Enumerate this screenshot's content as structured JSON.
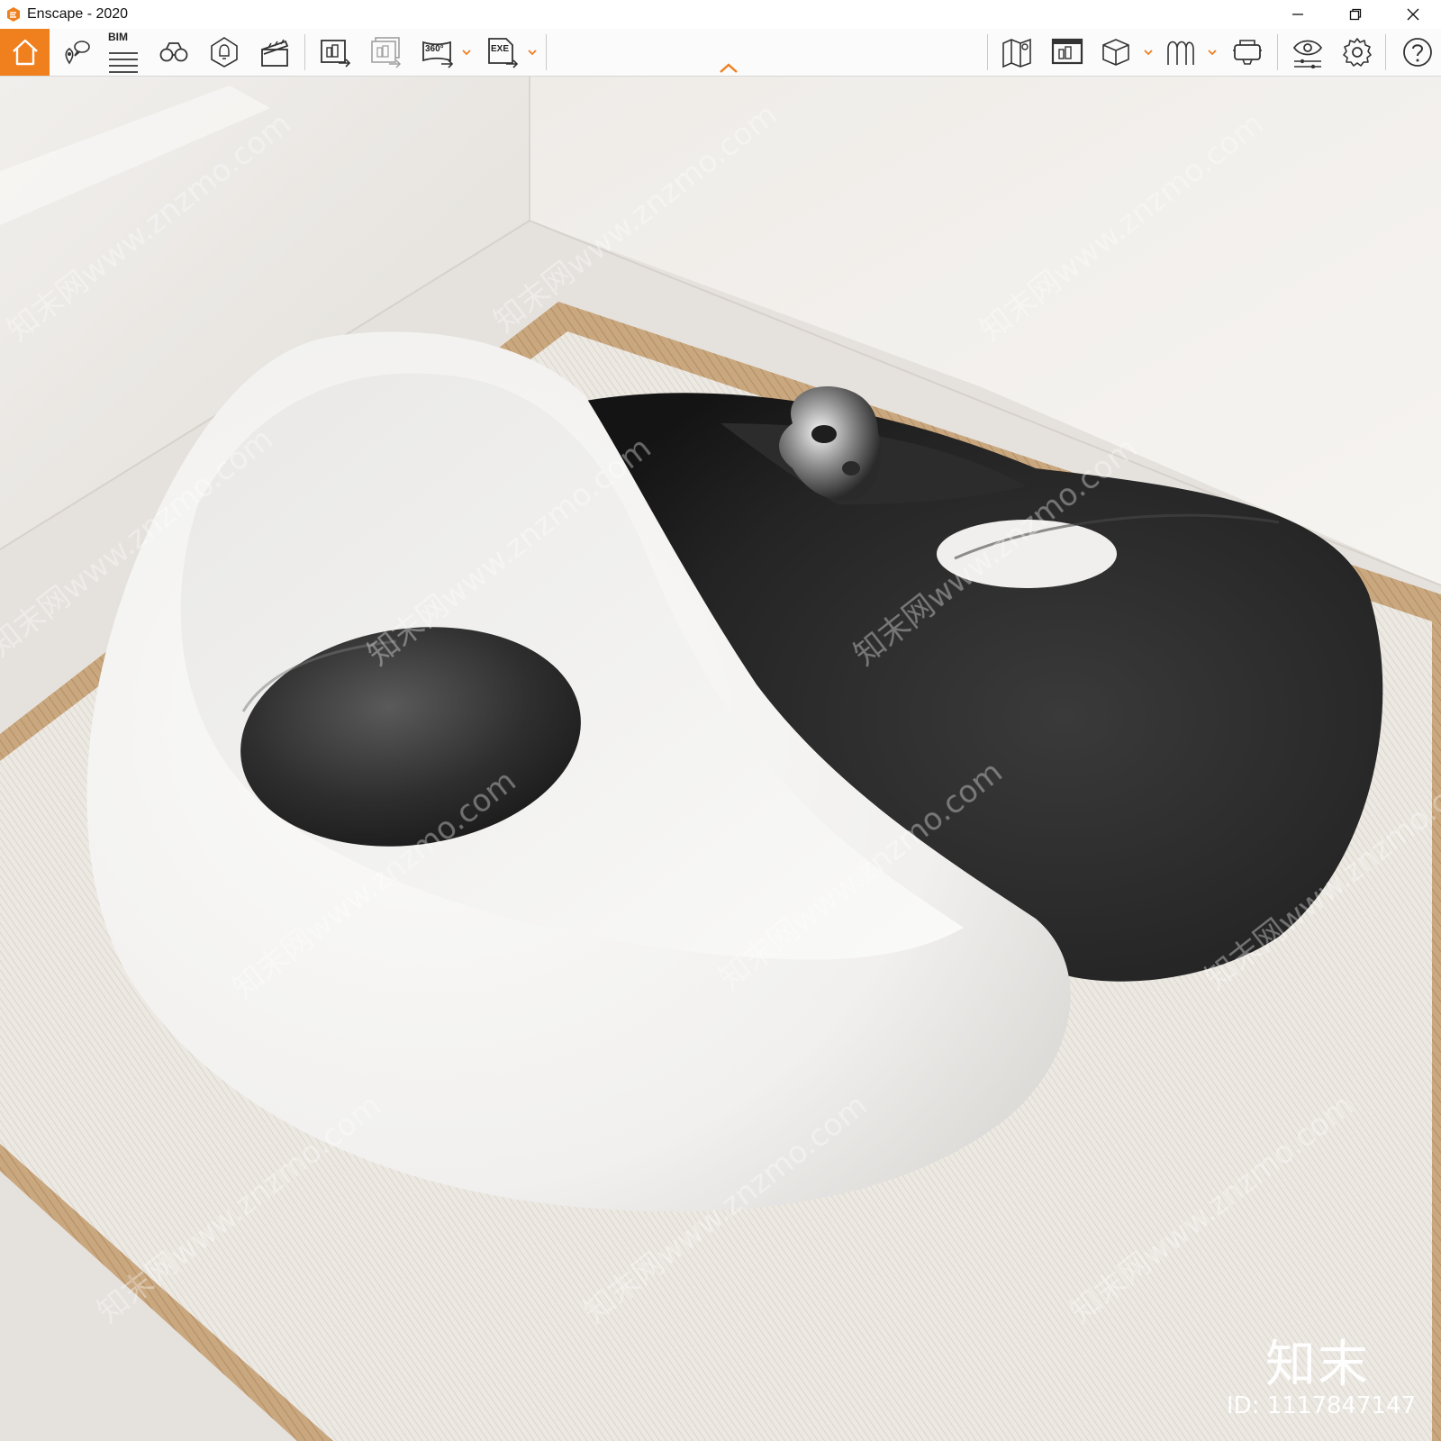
{
  "window": {
    "title": "Enscape - 2020",
    "accent_color": "#f07f1e"
  },
  "toolbar": {
    "bim_label": "BIM",
    "left_icons": [
      "home-icon",
      "location-pin-icon",
      "bim-panel-icon",
      "binoculars-icon",
      "light-icon",
      "clapperboard-icon"
    ],
    "export_icons": [
      "render-export-icon",
      "batch-export-icon",
      "panorama-360-icon",
      "exe-export-icon"
    ],
    "right_icons": [
      "map-icon",
      "asset-library-icon",
      "cube-view-icon",
      "mode-icon",
      "vr-headset-icon",
      "visual-settings-icon",
      "settings-gear-icon",
      "help-icon"
    ],
    "panorama_label": "360°",
    "exe_label": "EXE"
  },
  "watermark": {
    "logo": "知末",
    "id": "ID: 1117847147"
  }
}
